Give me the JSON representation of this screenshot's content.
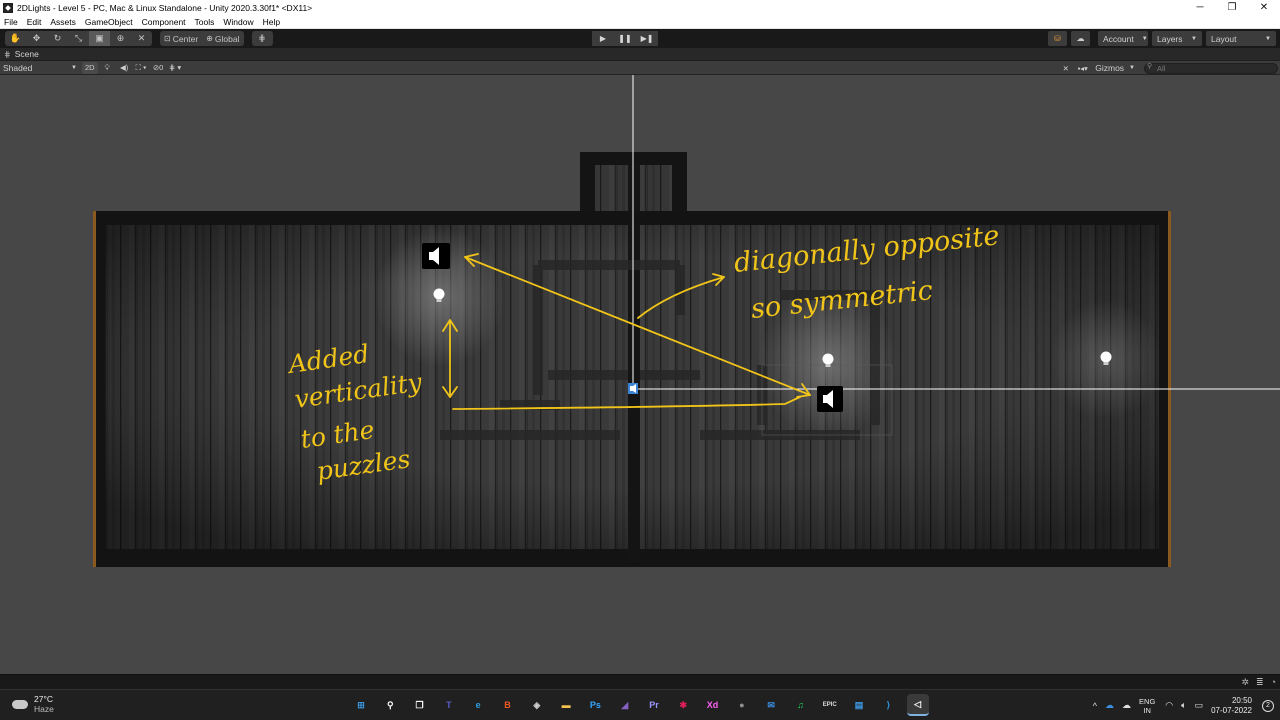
{
  "window": {
    "title": "2DLights - Level 5 - PC, Mac & Linux Standalone - Unity 2020.3.30f1* <DX11>",
    "controls": [
      "─",
      "❐",
      "✕"
    ]
  },
  "menu": [
    "File",
    "Edit",
    "Assets",
    "GameObject",
    "Component",
    "Tools",
    "Window",
    "Help"
  ],
  "toolbar": {
    "transform_tools": [
      {
        "name": "hand-tool",
        "glyph": "✋"
      },
      {
        "name": "move-tool",
        "glyph": "✥"
      },
      {
        "name": "rotate-tool",
        "glyph": "↻"
      },
      {
        "name": "scale-tool",
        "glyph": "⤡"
      },
      {
        "name": "rect-tool",
        "glyph": "▣"
      },
      {
        "name": "transform-tool",
        "glyph": "⊕"
      },
      {
        "name": "custom-tool",
        "glyph": "✕"
      }
    ],
    "pivot_label": "Center",
    "rotation_label": "Global",
    "play_buttons": [
      "▶",
      "❚❚",
      "▶❚"
    ],
    "account_label": "Account",
    "layers_label": "Layers",
    "layout_label": "Layout"
  },
  "scene_panel": {
    "tab_label": "Scene",
    "draw_mode": "Shaded",
    "mode_2d": "2D",
    "hidden_count": "0",
    "gizmos_label": "Gizmos",
    "search_placeholder": "All"
  },
  "annotations": {
    "note_right_line1": "diagonally opposite",
    "note_right_line2": "so symmetric",
    "note_left_line1": "Added",
    "note_left_line2": "verticality",
    "note_left_line3": "to the",
    "note_left_line4": "puzzles",
    "color": "#f0c419"
  },
  "taskbar": {
    "temperature": "27°C",
    "weather": "Haze",
    "apps": [
      {
        "name": "windows-start",
        "label": "⊞",
        "color": "#3a96dd"
      },
      {
        "name": "search",
        "label": "⚲",
        "color": "#ffffff"
      },
      {
        "name": "task-view",
        "label": "❐",
        "color": "#ffffff"
      },
      {
        "name": "teams",
        "label": "T",
        "color": "#5b5fc7"
      },
      {
        "name": "edge",
        "label": "e",
        "color": "#2d9fe0"
      },
      {
        "name": "brave",
        "label": "B",
        "color": "#f05a22"
      },
      {
        "name": "unity-hub",
        "label": "◈",
        "color": "#cccccc"
      },
      {
        "name": "file-explorer",
        "label": "▬",
        "color": "#f2c14e"
      },
      {
        "name": "photoshop",
        "label": "Ps",
        "color": "#31a8ff"
      },
      {
        "name": "visual-studio",
        "label": "◢",
        "color": "#8661c5"
      },
      {
        "name": "premiere",
        "label": "Pr",
        "color": "#9999ff"
      },
      {
        "name": "slack",
        "label": "✱",
        "color": "#e01e5a"
      },
      {
        "name": "xd",
        "label": "Xd",
        "color": "#ff61f6"
      },
      {
        "name": "github",
        "label": "●",
        "color": "#8f8f8f"
      },
      {
        "name": "mail",
        "label": "✉",
        "color": "#3b8ee0"
      },
      {
        "name": "spotify",
        "label": "♫",
        "color": "#1ed760"
      },
      {
        "name": "epic-games",
        "label": "EPIC",
        "color": "#dddddd"
      },
      {
        "name": "store",
        "label": "▤",
        "color": "#3f9be6"
      },
      {
        "name": "vscode",
        "label": "⟩",
        "color": "#2f9be8"
      },
      {
        "name": "unity-editor",
        "label": "◁",
        "color": "#ffffff"
      }
    ],
    "lang_top": "ENG",
    "lang_bottom": "IN",
    "time": "20:50",
    "date": "07-07-2022",
    "notification_count": "2"
  }
}
